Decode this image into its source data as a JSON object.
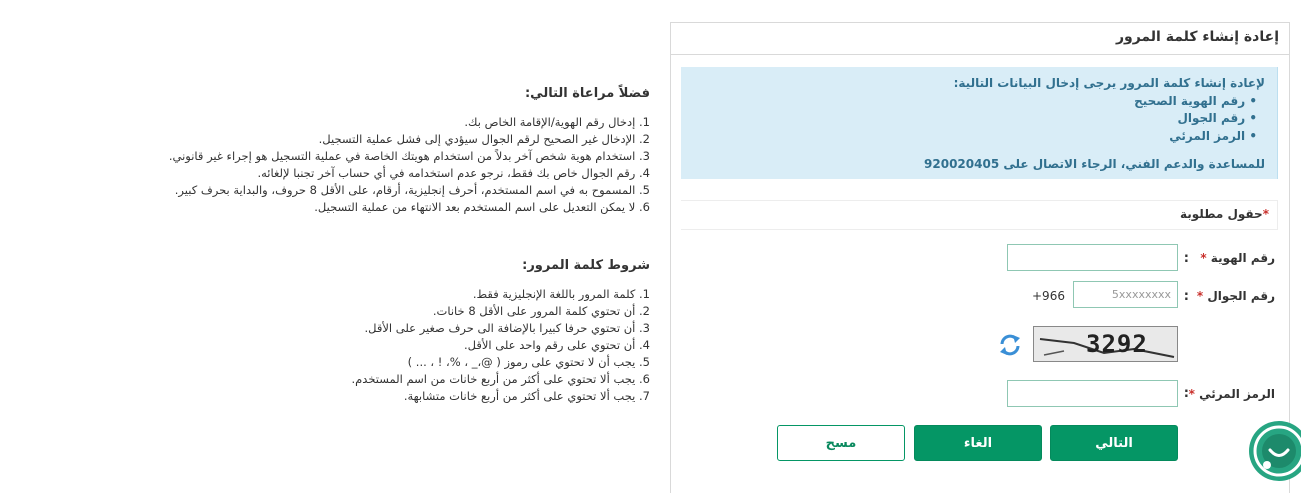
{
  "panel": {
    "title": "إعادة إنشاء كلمة المرور",
    "info": {
      "intro": "لإعادة إنشاء كلمة المرور يرجى إدخال البيانات التالية:",
      "items": [
        "رقم الهوية الصحيح",
        "رقم الجوال",
        "الرمز المرئي"
      ],
      "support": "للمساعدة والدعم الفني، الرجاء الاتصال على 920020405"
    },
    "required_note": "حقول مطلوبة",
    "required_star": "*",
    "fields": {
      "id_label": "رقم الهوية",
      "mobile_label": "رقم الجوال",
      "mobile_placeholder": "5xxxxxxxx",
      "mobile_prefix": "+966",
      "captcha_label": "الرمز المرئي",
      "colon": ":",
      "captcha_text": "3292"
    },
    "buttons": {
      "next": "التالي",
      "cancel": "الغاء",
      "clear": "مسح"
    }
  },
  "notes": {
    "title": "فضلاً مراعاة التالي:",
    "items": [
      "1. إدخال رقم الهوية/الإقامة الخاص بك.",
      "2. الإدخال غير الصحيح لرقم الجوال سيؤدي إلى فشل عملية التسجيل.",
      "3. استخدام هوية شخص آخر بدلاً من استخدام هويتك الخاصة في عملية التسجيل هو إجراء غير قانوني.",
      "4. رقم الجوال خاص بك فقط، نرجو عدم استخدامه في أي حساب آخر تجنبا لإلغائه.",
      "5. المسموح به في اسم المستخدم، أحرف إنجليزية، أرقام، على الأقل 8 حروف، والبداية بحرف كبير.",
      "6. لا يمكن التعديل على اسم المستخدم بعد الانتهاء من عملية التسجيل."
    ]
  },
  "password_rules": {
    "title": "شروط كلمة المرور:",
    "items": [
      "1. كلمة المرور باللغة الإنجليزية فقط.",
      "2. أن تحتوي كلمة المرور على الأقل 8 خانات.",
      "3. أن تحتوي حرفا كبيرا بالإضافة الى حرف صغير على الأقل.",
      "4. أن تحتوي على رقم واحد على الأقل.",
      "5. يجب أن لا تحتوي على رموز ( @،_ ، %، ! ، ... )",
      "6. يجب ألا تحتوي على أكثر من أربع خانات من اسم المستخدم.",
      "7. يجب ألا تحتوي على أكثر من أربع خانات متشابهة."
    ]
  },
  "colors": {
    "primary_green": "#059665",
    "info_bg": "#d9edf7",
    "info_text": "#31708f",
    "required_red": "#c9302c",
    "chat_green": "#27a582"
  }
}
